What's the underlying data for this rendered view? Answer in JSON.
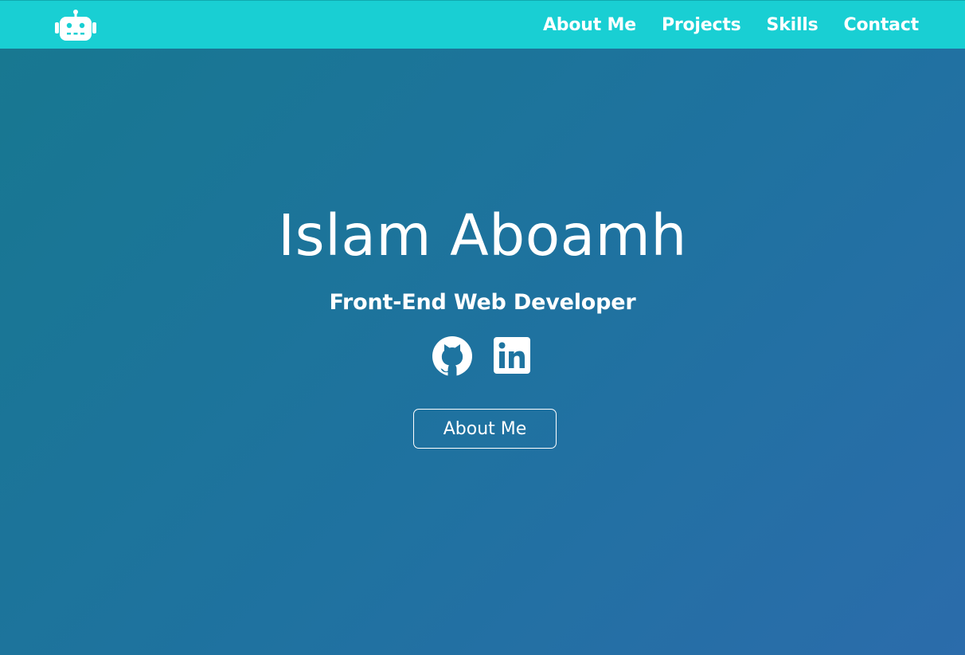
{
  "header": {
    "logo_icon": "robot-icon",
    "nav": [
      {
        "label": "About Me"
      },
      {
        "label": "Projects"
      },
      {
        "label": "Skills"
      },
      {
        "label": "Contact"
      }
    ]
  },
  "hero": {
    "name": "Islam Aboamh",
    "role": "Front-End Web Developer",
    "social": [
      {
        "icon": "github-icon"
      },
      {
        "icon": "linkedin-icon"
      }
    ],
    "button_label": "About Me"
  },
  "colors": {
    "navbar": "#19cfd3",
    "gradient_start": "#177890",
    "gradient_end": "#2b6cab",
    "text": "#ffffff"
  }
}
